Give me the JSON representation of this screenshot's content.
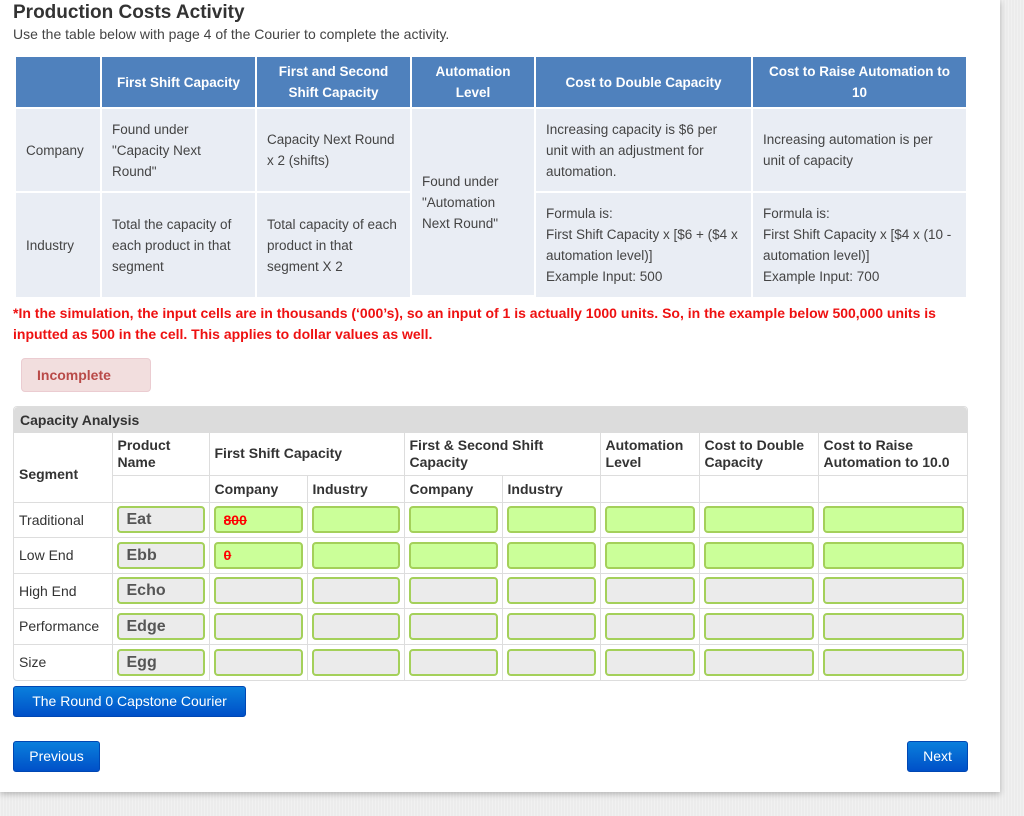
{
  "page": {
    "title": "Production Costs Activity",
    "subtitle": "Use the table below with page 4 of the Courier to complete the activity."
  },
  "info_table": {
    "headers": [
      "",
      "First Shift Capacity",
      "First and Second Shift Capacity",
      "Automation Level",
      "Cost to Double Capacity",
      "Cost to Raise Automation to 10"
    ],
    "rows": {
      "company": {
        "label": "Company",
        "first_shift": "Found under \"Capacity Next Round\"",
        "first_second_shift": "Capacity Next Round x 2 (shifts)",
        "cost_double": "Increasing capacity is $6 per unit with an adjustment for automation.",
        "cost_raise": "Increasing automation is per unit of capacity"
      },
      "industry": {
        "label": "Industry",
        "first_shift": "Total the capacity of each product in that segment",
        "first_second_shift": "Total capacity of each product in that segment X 2",
        "cost_double_formula_label": "Formula is:",
        "cost_double_formula": "First Shift Capacity x [$6 + ($4 x automation level)]",
        "cost_double_example": "Example Input: 500",
        "cost_raise_formula_label": "Formula is:",
        "cost_raise_formula": "First Shift Capacity x [$4 x (10 - automation level)]",
        "cost_raise_example": "Example Input: 700"
      },
      "automation_level": "Found under \"Automation Next Round\""
    }
  },
  "note": "*In the simulation, the input cells are in thousands (‘000’s), so an input of 1 is actually 1000 units. So, in the example below 500,000 units is inputted as 500 in the cell. This applies to dollar values as well.",
  "status_badge": "Incomplete",
  "capacity_analysis": {
    "title": "Capacity Analysis",
    "headers": {
      "segment": "Segment",
      "product_name": "Product Name",
      "first_shift": "First Shift Capacity",
      "first_second_shift": "First & Second Shift Capacity",
      "automation_level": "Automation Level",
      "cost_double": "Cost to Double Capacity",
      "cost_raise": "Cost to Raise Automation to 10.0",
      "company": "Company",
      "industry": "Industry"
    },
    "rows": [
      {
        "segment": "Traditional",
        "product": "Eat",
        "first_shift_company": "800",
        "first_shift_industry": "",
        "fs2_company": "",
        "fs2_industry": "",
        "automation": "",
        "cost_double": "",
        "cost_raise": "",
        "state": "active"
      },
      {
        "segment": "Low End",
        "product": "Ebb",
        "first_shift_company": "0",
        "first_shift_industry": "",
        "fs2_company": "",
        "fs2_industry": "",
        "automation": "",
        "cost_double": "",
        "cost_raise": "",
        "state": "active"
      },
      {
        "segment": "High End",
        "product": "Echo",
        "first_shift_company": "",
        "first_shift_industry": "",
        "fs2_company": "",
        "fs2_industry": "",
        "automation": "",
        "cost_double": "",
        "cost_raise": "",
        "state": "locked"
      },
      {
        "segment": "Performance",
        "product": "Edge",
        "first_shift_company": "",
        "first_shift_industry": "",
        "fs2_company": "",
        "fs2_industry": "",
        "automation": "",
        "cost_double": "",
        "cost_raise": "",
        "state": "locked"
      },
      {
        "segment": "Size",
        "product": "Egg",
        "first_shift_company": "",
        "first_shift_industry": "",
        "fs2_company": "",
        "fs2_industry": "",
        "automation": "",
        "cost_double": "",
        "cost_raise": "",
        "state": "locked"
      }
    ]
  },
  "buttons": {
    "courier": "The Round 0 Capstone Courier",
    "previous": "Previous",
    "next": "Next"
  },
  "colors": {
    "header_blue": "#4f81bd",
    "cell_bg": "#e9edf4",
    "note_red": "#ee1111",
    "input_green": "#cbff99",
    "input_border": "#a4d05a",
    "button_blue": "#0a6fd8"
  }
}
